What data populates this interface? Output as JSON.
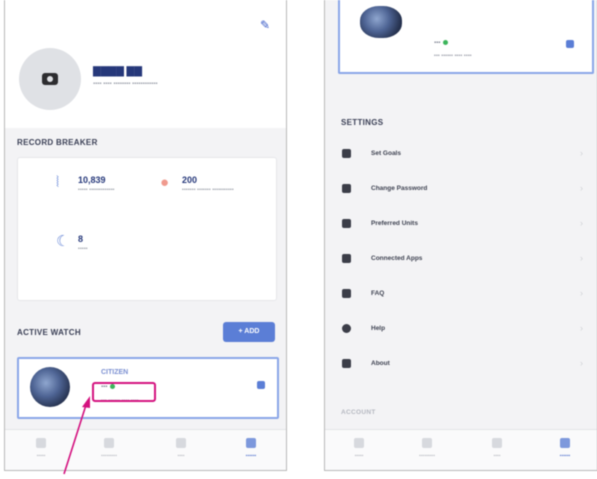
{
  "left_screen": {
    "edit_icon": "pencil-icon",
    "profile": {
      "name": "▇▇▇▇ ▇▇",
      "subtitle": "▪▪▪▪ ▪▪▪▪ ▪▪▪▪▪▪▪▪ ▪▪▪▪▪▪▪▪▪▪▪▪"
    },
    "record_breaker": {
      "heading": "RECORD BREAKER",
      "items": [
        {
          "icon": "steps-icon",
          "value": "10,839",
          "label": "▪▪▪▪▪ ▪▪▪▪▪▪▪▪▪▪▪▪▪"
        },
        {
          "icon": "heart-icon",
          "value": "200",
          "label": "▪▪▪▪▪▪▪ ▪▪▪▪▪▪▪ ▪▪▪▪▪▪▪▪▪▪▪"
        },
        {
          "icon": "sleep-icon",
          "value": "8",
          "label": "▪▪▪▪▪"
        }
      ]
    },
    "active_watch": {
      "heading": "ACTIVE WATCH",
      "add_label": "+ ADD",
      "brand": "CITIZEN",
      "status": "▪▪▪",
      "sync": "▪▪▪ ▪▪▪▪▪▪ ▪▪▪▪ ▪▪▪▪"
    },
    "tabs": [
      {
        "label": "▪▪▪▪▪",
        "active": false
      },
      {
        "label": "▪▪▪▪▪▪▪▪▪",
        "active": false
      },
      {
        "label": "▪▪▪▪",
        "active": false
      },
      {
        "label": "▪▪▪▪▪▪",
        "active": true
      }
    ]
  },
  "right_screen": {
    "edit_icon": "pencil-icon",
    "top_watch": {
      "status": "▪▪▪",
      "sync": "▪▪▪ ▪▪▪▪▪▪ ▪▪▪▪ ▪▪▪▪"
    },
    "settings": {
      "heading": "SETTINGS",
      "items": [
        {
          "label": "Set Goals",
          "icon": "target-icon"
        },
        {
          "label": "Change Password",
          "icon": "lock-icon"
        },
        {
          "label": "Preferred Units",
          "icon": "units-icon"
        },
        {
          "label": "Connected Apps",
          "icon": "apps-icon"
        },
        {
          "label": "FAQ",
          "icon": "faq-icon"
        },
        {
          "label": "Help",
          "icon": "help-icon"
        },
        {
          "label": "About",
          "icon": "about-icon"
        }
      ],
      "footer_heading": "ACCOUNT"
    },
    "tabs": [
      {
        "label": "▪▪▪▪▪",
        "active": false
      },
      {
        "label": "▪▪▪▪▪▪▪▪▪",
        "active": false
      },
      {
        "label": "▪▪▪▪",
        "active": false
      },
      {
        "label": "▪▪▪▪▪▪",
        "active": true
      }
    ]
  },
  "colors": {
    "accent": "#5b7ed6",
    "highlight": "#d4127f",
    "status_ok": "#3cb55b"
  }
}
